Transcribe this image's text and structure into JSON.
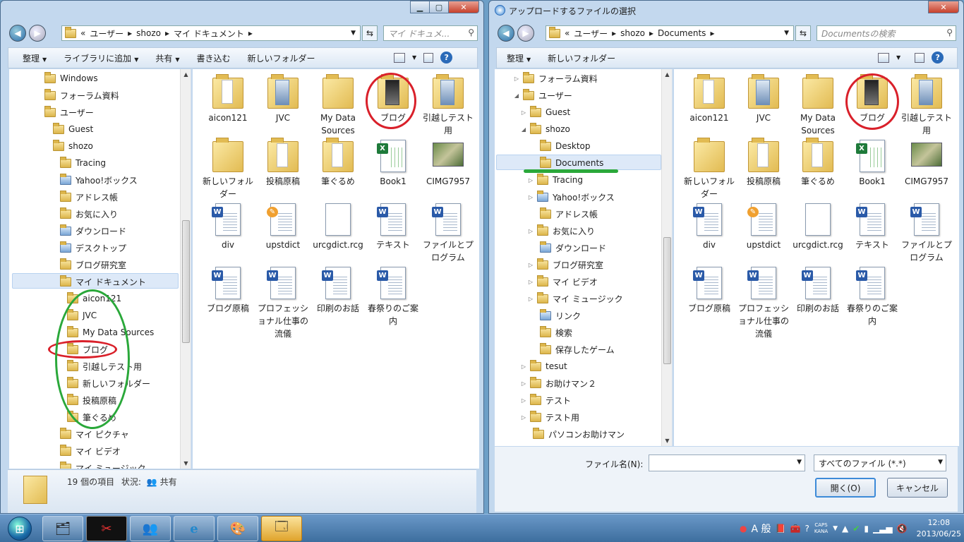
{
  "left_window": {
    "breadcrumb_prefix": "«",
    "breadcrumb": [
      "ユーザー",
      "shozo",
      "マイ ドキュメント"
    ],
    "search_placeholder": "マイ ドキュメ...",
    "commands": [
      "整理",
      "ライブラリに追加",
      "共有",
      "書き込む",
      "新しいフォルダー"
    ],
    "tree": [
      {
        "label": "Windows",
        "icon": "folder"
      },
      {
        "label": "フォーラム資料",
        "icon": "folder"
      },
      {
        "label": "ユーザー",
        "icon": "folder"
      },
      {
        "label": "Guest",
        "icon": "folder"
      },
      {
        "label": "shozo",
        "icon": "folder"
      },
      {
        "label": "Tracing",
        "icon": "folder"
      },
      {
        "label": "Yahoo!ボックス",
        "icon": "special"
      },
      {
        "label": "アドレス帳",
        "icon": "folder"
      },
      {
        "label": "お気に入り",
        "icon": "folder"
      },
      {
        "label": "ダウンロード",
        "icon": "special"
      },
      {
        "label": "デスクトップ",
        "icon": "special"
      },
      {
        "label": "ブログ研究室",
        "icon": "folder"
      },
      {
        "label": "マイ ドキュメント",
        "icon": "folder",
        "selected": true
      },
      {
        "label": "aicon121",
        "icon": "folder"
      },
      {
        "label": "JVC",
        "icon": "folder"
      },
      {
        "label": "My Data Sources",
        "icon": "folder"
      },
      {
        "label": "ブログ",
        "icon": "folder"
      },
      {
        "label": "引越しテスト用",
        "icon": "folder"
      },
      {
        "label": "新しいフォルダー",
        "icon": "folder"
      },
      {
        "label": "投稿原稿",
        "icon": "folder"
      },
      {
        "label": "筆ぐるめ",
        "icon": "folder"
      },
      {
        "label": "マイ ピクチャ",
        "icon": "folder"
      },
      {
        "label": "マイ ビデオ",
        "icon": "folder"
      },
      {
        "label": "マイ ミュージック",
        "icon": "folder"
      }
    ],
    "items": [
      {
        "label": "aicon121",
        "type": "folder-doc"
      },
      {
        "label": "JVC",
        "type": "folder-blue"
      },
      {
        "label": "My Data Sources",
        "type": "folder"
      },
      {
        "label": "ブログ",
        "type": "folder-dark"
      },
      {
        "label": "引越しテスト用",
        "type": "folder-blue"
      },
      {
        "label": "新しいフォルダー",
        "type": "folder"
      },
      {
        "label": "投稿原稿",
        "type": "folder-doc"
      },
      {
        "label": "筆ぐるめ",
        "type": "folder-doc"
      },
      {
        "label": "Book1",
        "type": "excel"
      },
      {
        "label": "CIMG7957",
        "type": "photo"
      },
      {
        "label": "div",
        "type": "word"
      },
      {
        "label": "upstdict",
        "type": "publisher"
      },
      {
        "label": "urcgdict.rcg",
        "type": "blank"
      },
      {
        "label": "テキスト",
        "type": "word"
      },
      {
        "label": "ファイルとプログラム",
        "type": "word"
      },
      {
        "label": "ブログ原稿",
        "type": "word"
      },
      {
        "label": "プロフェッショナル仕事の流儀",
        "type": "word"
      },
      {
        "label": "印刷のお話",
        "type": "word"
      },
      {
        "label": "春祭りのご案内",
        "type": "word"
      }
    ],
    "status_count": "19 個の項目",
    "status_label": "状況:",
    "status_value": "共有"
  },
  "right_window": {
    "title": "アップロードするファイルの選択",
    "breadcrumb_prefix": "«",
    "breadcrumb": [
      "ユーザー",
      "shozo",
      "Documents"
    ],
    "search_placeholder": "Documentsの検索",
    "commands": [
      "整理",
      "新しいフォルダー"
    ],
    "tree": [
      {
        "label": "フォーラム資料",
        "icon": "folder"
      },
      {
        "label": "ユーザー",
        "icon": "folder"
      },
      {
        "label": "Guest",
        "icon": "folder"
      },
      {
        "label": "shozo",
        "icon": "folder"
      },
      {
        "label": "Desktop",
        "icon": "folder"
      },
      {
        "label": "Documents",
        "icon": "folder",
        "selected": true
      },
      {
        "label": "Tracing",
        "icon": "folder"
      },
      {
        "label": "Yahoo!ボックス",
        "icon": "special"
      },
      {
        "label": "アドレス帳",
        "icon": "folder"
      },
      {
        "label": "お気に入り",
        "icon": "folder"
      },
      {
        "label": "ダウンロード",
        "icon": "special"
      },
      {
        "label": "ブログ研究室",
        "icon": "folder"
      },
      {
        "label": "マイ ビデオ",
        "icon": "folder"
      },
      {
        "label": "マイ ミュージック",
        "icon": "folder"
      },
      {
        "label": "リンク",
        "icon": "special"
      },
      {
        "label": "検索",
        "icon": "folder"
      },
      {
        "label": "保存したゲーム",
        "icon": "folder"
      },
      {
        "label": "tesut",
        "icon": "folder"
      },
      {
        "label": "お助けマン２",
        "icon": "folder"
      },
      {
        "label": "テスト",
        "icon": "folder"
      },
      {
        "label": "テスト用",
        "icon": "folder"
      },
      {
        "label": "パソコンお助けマン",
        "icon": "folder"
      }
    ],
    "items": [
      {
        "label": "aicon121",
        "type": "folder-doc"
      },
      {
        "label": "JVC",
        "type": "folder-blue"
      },
      {
        "label": "My Data Sources",
        "type": "folder"
      },
      {
        "label": "ブログ",
        "type": "folder-dark"
      },
      {
        "label": "引越しテスト用",
        "type": "folder-blue"
      },
      {
        "label": "新しいフォルダー",
        "type": "folder"
      },
      {
        "label": "投稿原稿",
        "type": "folder-doc"
      },
      {
        "label": "筆ぐるめ",
        "type": "folder-doc"
      },
      {
        "label": "Book1",
        "type": "excel"
      },
      {
        "label": "CIMG7957",
        "type": "photo"
      },
      {
        "label": "div",
        "type": "word"
      },
      {
        "label": "upstdict",
        "type": "publisher"
      },
      {
        "label": "urcgdict.rcg",
        "type": "blank"
      },
      {
        "label": "テキスト",
        "type": "word"
      },
      {
        "label": "ファイルとプログラム",
        "type": "word"
      },
      {
        "label": "ブログ原稿",
        "type": "word"
      },
      {
        "label": "プロフェッショナル仕事の流儀",
        "type": "word"
      },
      {
        "label": "印刷のお話",
        "type": "word"
      },
      {
        "label": "春祭りのご案内",
        "type": "word"
      }
    ],
    "filename_label": "ファイル名(N):",
    "filename_value": "",
    "filetype_value": "すべてのファイル (*.*)",
    "open_button": "開く(O)",
    "cancel_button": "キャンセル"
  },
  "taskbar": {
    "ime_mode": "A 般",
    "caps": "CAPS",
    "kana": "KANA",
    "time": "12:08",
    "date": "2013/06/25"
  },
  "colors": {
    "annotation_red": "#d9202a",
    "annotation_green": "#2aa83a"
  }
}
